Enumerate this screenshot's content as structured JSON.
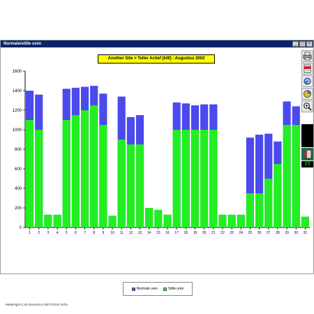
{
  "window": {
    "title": "Normale/stille uren",
    "buttons": [
      "_",
      "□",
      "×"
    ]
  },
  "toolbar": {
    "icons": [
      "printer-icon",
      "pdf-icon",
      "refresh-icon",
      "pie-icon",
      "zoom-icon",
      "exit-icon"
    ],
    "counter": "15"
  },
  "footer": {
    "text": "Webknight 5.30 licenced to DEXTRON Imfra"
  },
  "colors": {
    "normale": "#4a4aee",
    "stille": "#22ee22",
    "title_bg": "#ffff00",
    "titlebar": "#0a246a"
  },
  "chart_data": {
    "type": "bar",
    "title": "Another Site > Teller Actief [kW] : Augustus 2002",
    "xlabel": "",
    "ylabel": "",
    "ylim": [
      0,
      1600
    ],
    "yticks": [
      0,
      200,
      400,
      600,
      800,
      1000,
      1200,
      1400,
      1600
    ],
    "grid": false,
    "legend_position": "bottom-center",
    "categories": [
      "1",
      "2",
      "3",
      "4",
      "5",
      "6",
      "7",
      "8",
      "9",
      "10",
      "11",
      "12",
      "13",
      "14",
      "15",
      "16",
      "17",
      "18",
      "19",
      "20",
      "21",
      "22",
      "23",
      "24",
      "25",
      "26",
      "27",
      "28",
      "29",
      "30",
      "31"
    ],
    "series": [
      {
        "name": "Normale uren",
        "values": [
          1400,
          1360,
          130,
          130,
          1420,
          1430,
          1440,
          1450,
          1370,
          120,
          1340,
          1130,
          1150,
          200,
          180,
          130,
          1280,
          1270,
          1250,
          1260,
          1260,
          130,
          130,
          130,
          920,
          950,
          960,
          880,
          1290,
          1240,
          110
        ]
      },
      {
        "name": "Stille uren",
        "values": [
          1100,
          1000,
          130,
          130,
          1100,
          1150,
          1200,
          1250,
          1050,
          120,
          900,
          850,
          850,
          200,
          180,
          130,
          1000,
          1000,
          1000,
          1000,
          1000,
          130,
          130,
          130,
          350,
          350,
          500,
          650,
          1050,
          1050,
          110
        ]
      }
    ]
  }
}
